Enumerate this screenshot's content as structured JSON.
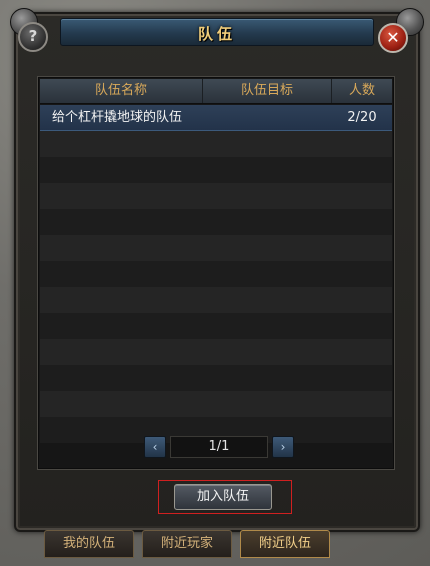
{
  "window": {
    "title": "队伍",
    "help_icon_glyph": "?",
    "close_icon_glyph": "✕"
  },
  "table": {
    "columns": [
      "队伍名称",
      "队伍目标",
      "人数"
    ],
    "rows": [
      {
        "name": "给个杠杆撬地球的队伍",
        "goal": "",
        "count": "2/20"
      }
    ]
  },
  "pager": {
    "page_text": "1/1",
    "prev_glyph": "‹",
    "next_glyph": "›"
  },
  "join_button_label": "加入队伍",
  "tabs": [
    {
      "label": "我的队伍"
    },
    {
      "label": "附近玩家"
    },
    {
      "label": "附近队伍",
      "active": true
    }
  ],
  "colors": {
    "title_text": "#f0cd7a",
    "header_text": "#d9a95a",
    "selected_row": "#2e4058",
    "join_highlight": "#d02020"
  }
}
